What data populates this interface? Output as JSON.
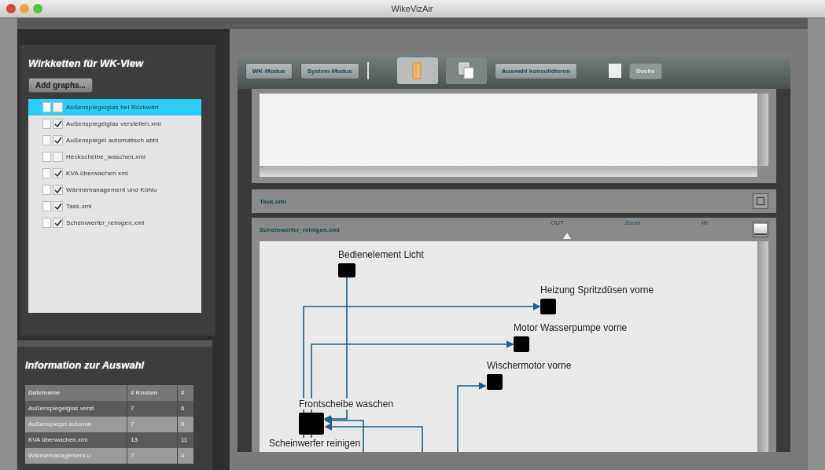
{
  "window": {
    "title": "WikeVizAir"
  },
  "left_panel": {
    "title": "Wirkketten für WK-View",
    "add_button": "Add graphs...",
    "files": [
      {
        "label": "Außenspiegelglas bei Rückwärt",
        "checked": false,
        "selected": true
      },
      {
        "label": "Außenspiegelglas verstellen.xml",
        "checked": true,
        "selected": false
      },
      {
        "label": "Außenspiegel automatisch abbl",
        "checked": true,
        "selected": false
      },
      {
        "label": "Heckscheibe_waschen.xml",
        "checked": false,
        "selected": false
      },
      {
        "label": "KVA überwachen.xml",
        "checked": true,
        "selected": false
      },
      {
        "label": "Wärmemanagement und Kühlu",
        "checked": true,
        "selected": false
      },
      {
        "label": "Task.xml",
        "checked": true,
        "selected": false
      },
      {
        "label": "Scheinwerfer_reinigen.xml",
        "checked": true,
        "selected": false
      }
    ]
  },
  "info_panel": {
    "title": "Information zur Auswahl",
    "columns": [
      "Dateiname",
      "# Knoten",
      "#"
    ],
    "rows": [
      [
        "Außenspiegelglas verst",
        "7",
        "6"
      ],
      [
        "Außenspiegel automat",
        "7",
        "6"
      ],
      [
        "KVA überwachen.xml",
        "13",
        "11"
      ],
      [
        "Wärmemanagement u",
        "7",
        "4"
      ]
    ]
  },
  "toolbar": {
    "items": [
      {
        "kind": "button",
        "label": "WK-Modus"
      },
      {
        "kind": "button",
        "label": "System-Modus"
      },
      {
        "kind": "separator"
      },
      {
        "kind": "folder",
        "selected": true
      },
      {
        "kind": "pages",
        "selected": false
      },
      {
        "kind": "button",
        "label": "Auswahl konsolidieren"
      },
      {
        "kind": "square"
      },
      {
        "kind": "button",
        "label": "Suche",
        "disabled": true
      }
    ]
  },
  "panes": [
    {
      "title": "Task.xml",
      "expanded": false
    },
    {
      "title": "Scheinwerfer_reinigen.xml",
      "expanded": true,
      "zoom": {
        "out_label": "OUT",
        "label": "Zoom",
        "in_label": "IN",
        "level": 0.08
      },
      "nodes": [
        {
          "label": "Bedienelement Licht"
        },
        {
          "label": "Heizung Spritzdüsen vorne"
        },
        {
          "label": "Motor Wasserpumpe vorne"
        },
        {
          "label": "Wischermotor vorne"
        },
        {
          "label": "Frontscheibe waschen"
        },
        {
          "label": "Scheinwerfer reinigen"
        }
      ]
    }
  ]
}
